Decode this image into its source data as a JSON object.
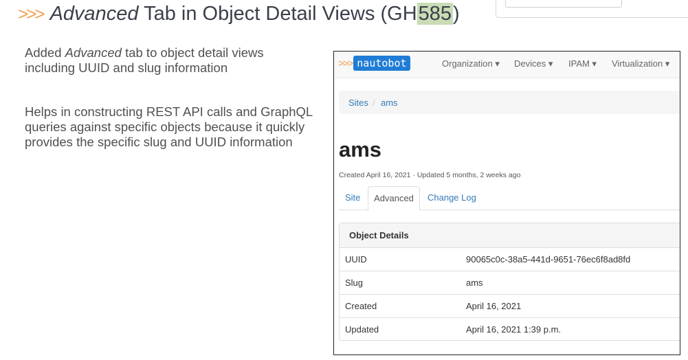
{
  "slide": {
    "chevrons": ">>>",
    "title_italic": "Advanced",
    "title_rest": " Tab in Object Detail Views (GH",
    "title_number": "585",
    "title_close": ")",
    "bullet1_pre": "Added ",
    "bullet1_italic": "Advanced",
    "bullet1_post": " tab to object detail views including UUID and slug information",
    "bullet2": "Helps in constructing REST API calls and GraphQL queries against specific objects because it quickly provides the specific slug and UUID information"
  },
  "app": {
    "brand_chevrons": ">>>",
    "brand_name": "nautobot",
    "nav": [
      "Organization ▾",
      "Devices ▾",
      "IPAM ▾",
      "Virtualization ▾"
    ],
    "breadcrumb": [
      "Sites",
      "/",
      "ams"
    ],
    "page_title": "ams",
    "meta": "Created April 16, 2021 · Updated 5 months, 2 weeks ago",
    "tabs": [
      "Site",
      "Advanced",
      "Change Log"
    ],
    "panel_title": "Object Details",
    "rows": [
      {
        "k": "UUID",
        "v": "90065c0c-38a5-441d-9651-76ec6f8ad8fd"
      },
      {
        "k": "Slug",
        "v": "ams"
      },
      {
        "k": "Created",
        "v": "April 16, 2021"
      },
      {
        "k": "Updated",
        "v": "April 16, 2021 1:39 p.m."
      }
    ]
  },
  "colors": {
    "accent": "#f0a050",
    "brand": "#1f7dd6",
    "link": "#337ab7",
    "highlight": "#c9dcb5"
  }
}
